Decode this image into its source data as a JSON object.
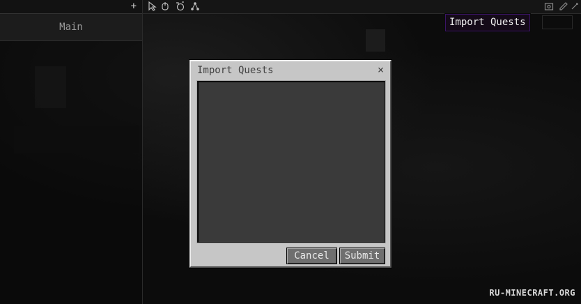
{
  "left_panel": {
    "add_label": "+",
    "tabs": [
      {
        "label": "Main"
      }
    ]
  },
  "toolbar": {
    "icons": [
      "cursor-icon",
      "hand-icon",
      "rotate-icon",
      "connect-icon",
      "screenshot-icon",
      "edit-icon",
      "settings-icon"
    ]
  },
  "tooltip": {
    "text": "Import Quests"
  },
  "dialog": {
    "title": "Import Quests",
    "close_label": "×",
    "textarea_value": "",
    "cancel_label": "Cancel",
    "submit_label": "Submit"
  },
  "watermark": {
    "text": "RU-MINECRAFT.ORG"
  },
  "colors": {
    "tooltip_border": "#3a1466",
    "dialog_bg": "#c6c6c6",
    "button_bg": "#6f6f6f"
  }
}
